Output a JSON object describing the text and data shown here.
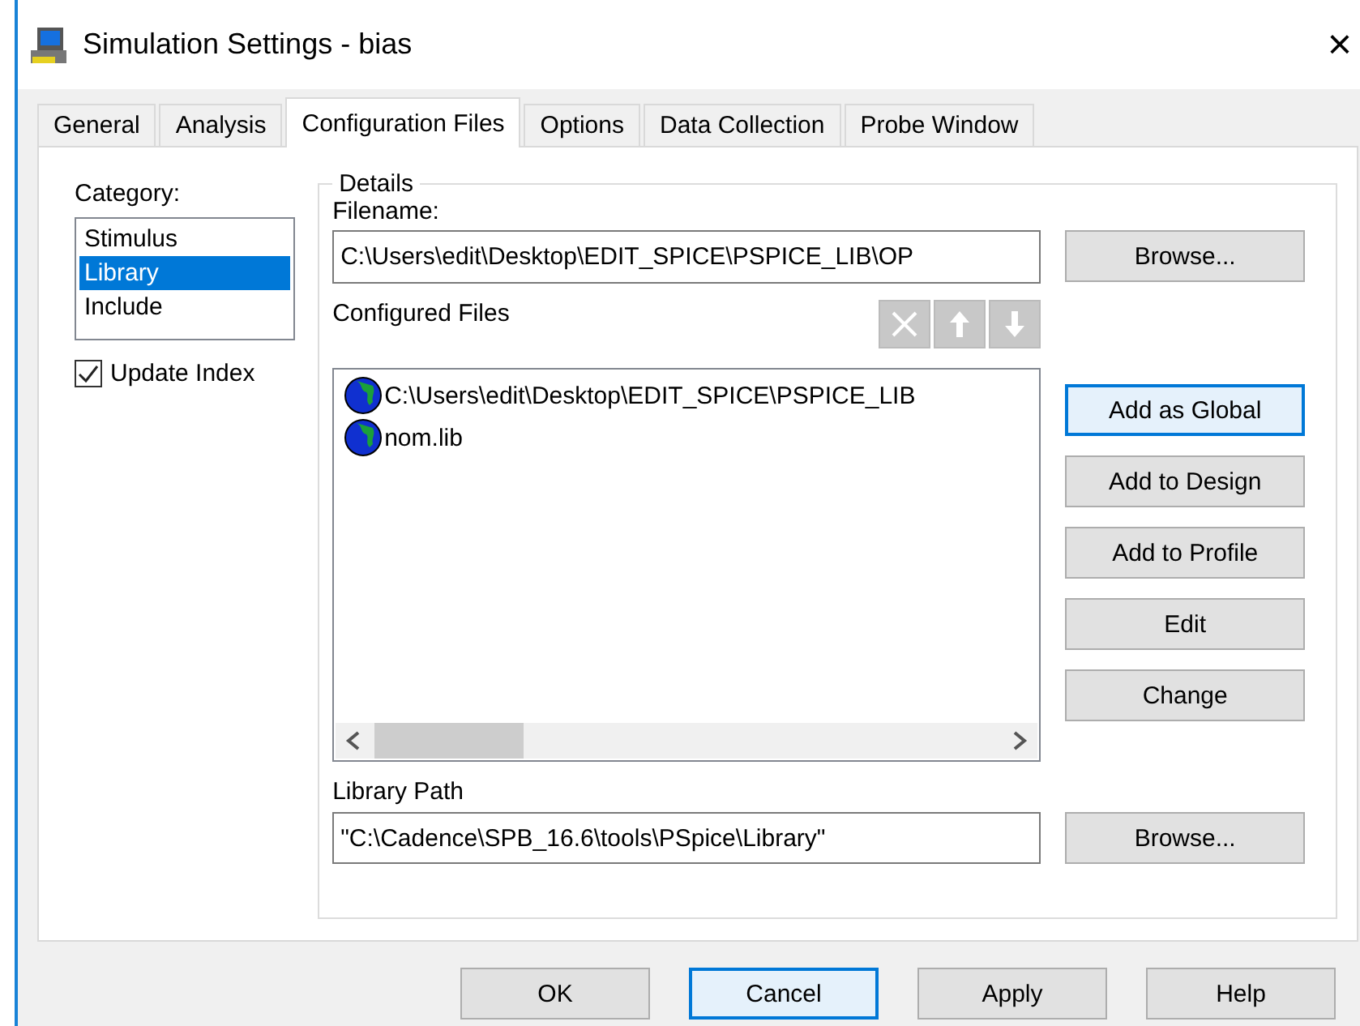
{
  "window": {
    "title": "Simulation Settings - bias",
    "close": "×"
  },
  "tabs": [
    {
      "label": "General",
      "selected": false
    },
    {
      "label": "Analysis",
      "selected": false
    },
    {
      "label": "Configuration Files",
      "selected": true
    },
    {
      "label": "Options",
      "selected": false
    },
    {
      "label": "Data Collection",
      "selected": false
    },
    {
      "label": "Probe Window",
      "selected": false
    }
  ],
  "category": {
    "label": "Category:",
    "items": [
      {
        "label": "Stimulus",
        "selected": false
      },
      {
        "label": "Library",
        "selected": true
      },
      {
        "label": "Include",
        "selected": false
      }
    ]
  },
  "update_index": {
    "label": "Update Index",
    "checked": true
  },
  "details": {
    "legend": "Details",
    "filename_label": "Filename:",
    "filename_value": "C:\\Users\\edit\\Desktop\\EDIT_SPICE\\PSPICE_LIB\\OP",
    "browse": "Browse...",
    "configured_label": "Configured Files",
    "files": [
      "C:\\Users\\edit\\Desktop\\EDIT_SPICE\\PSPICE_LIB",
      "nom.lib"
    ],
    "side_buttons": [
      {
        "label": "Add as Global",
        "focused": true
      },
      {
        "label": "Add to Design",
        "focused": false
      },
      {
        "label": "Add to Profile",
        "focused": false
      },
      {
        "label": "Edit",
        "focused": false
      },
      {
        "label": "Change",
        "focused": false
      }
    ],
    "library_path_label": "Library Path",
    "library_path_value": "\"C:\\Cadence\\SPB_16.6\\tools\\PSpice\\Library\"",
    "library_browse": "Browse..."
  },
  "buttons": [
    {
      "label": "OK",
      "focused": false
    },
    {
      "label": "Cancel",
      "focused": true
    },
    {
      "label": "Apply",
      "focused": false
    },
    {
      "label": "Help",
      "focused": false
    }
  ]
}
